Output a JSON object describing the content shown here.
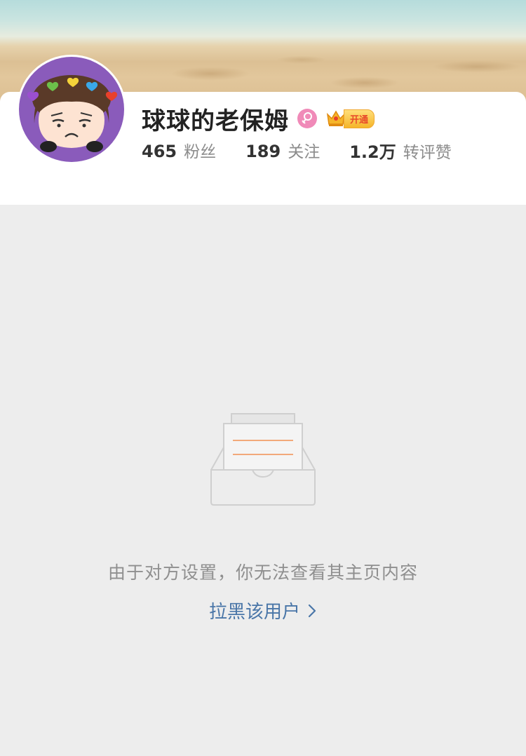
{
  "profile": {
    "username": "球球的老保姆",
    "gender": "female",
    "vip_label": "开通",
    "stats": [
      {
        "value": "465",
        "label": "粉丝"
      },
      {
        "value": "189",
        "label": "关注"
      },
      {
        "value": "1.2万",
        "label": "转评赞"
      }
    ]
  },
  "icons": {
    "avatar": "cartoon-girl-avatar",
    "gender": "female-icon",
    "vip": "crown-icon",
    "empty": "empty-inbox-icon",
    "link": "chevron-right-icon"
  },
  "empty_state": {
    "message": "由于对方设置，你无法查看其主页内容",
    "action_label": "拉黑该用户"
  },
  "colors": {
    "background": "#ededed",
    "link": "#4a76a8",
    "female": "#f08ab8",
    "avatar_ring": "#8a5bbb"
  }
}
